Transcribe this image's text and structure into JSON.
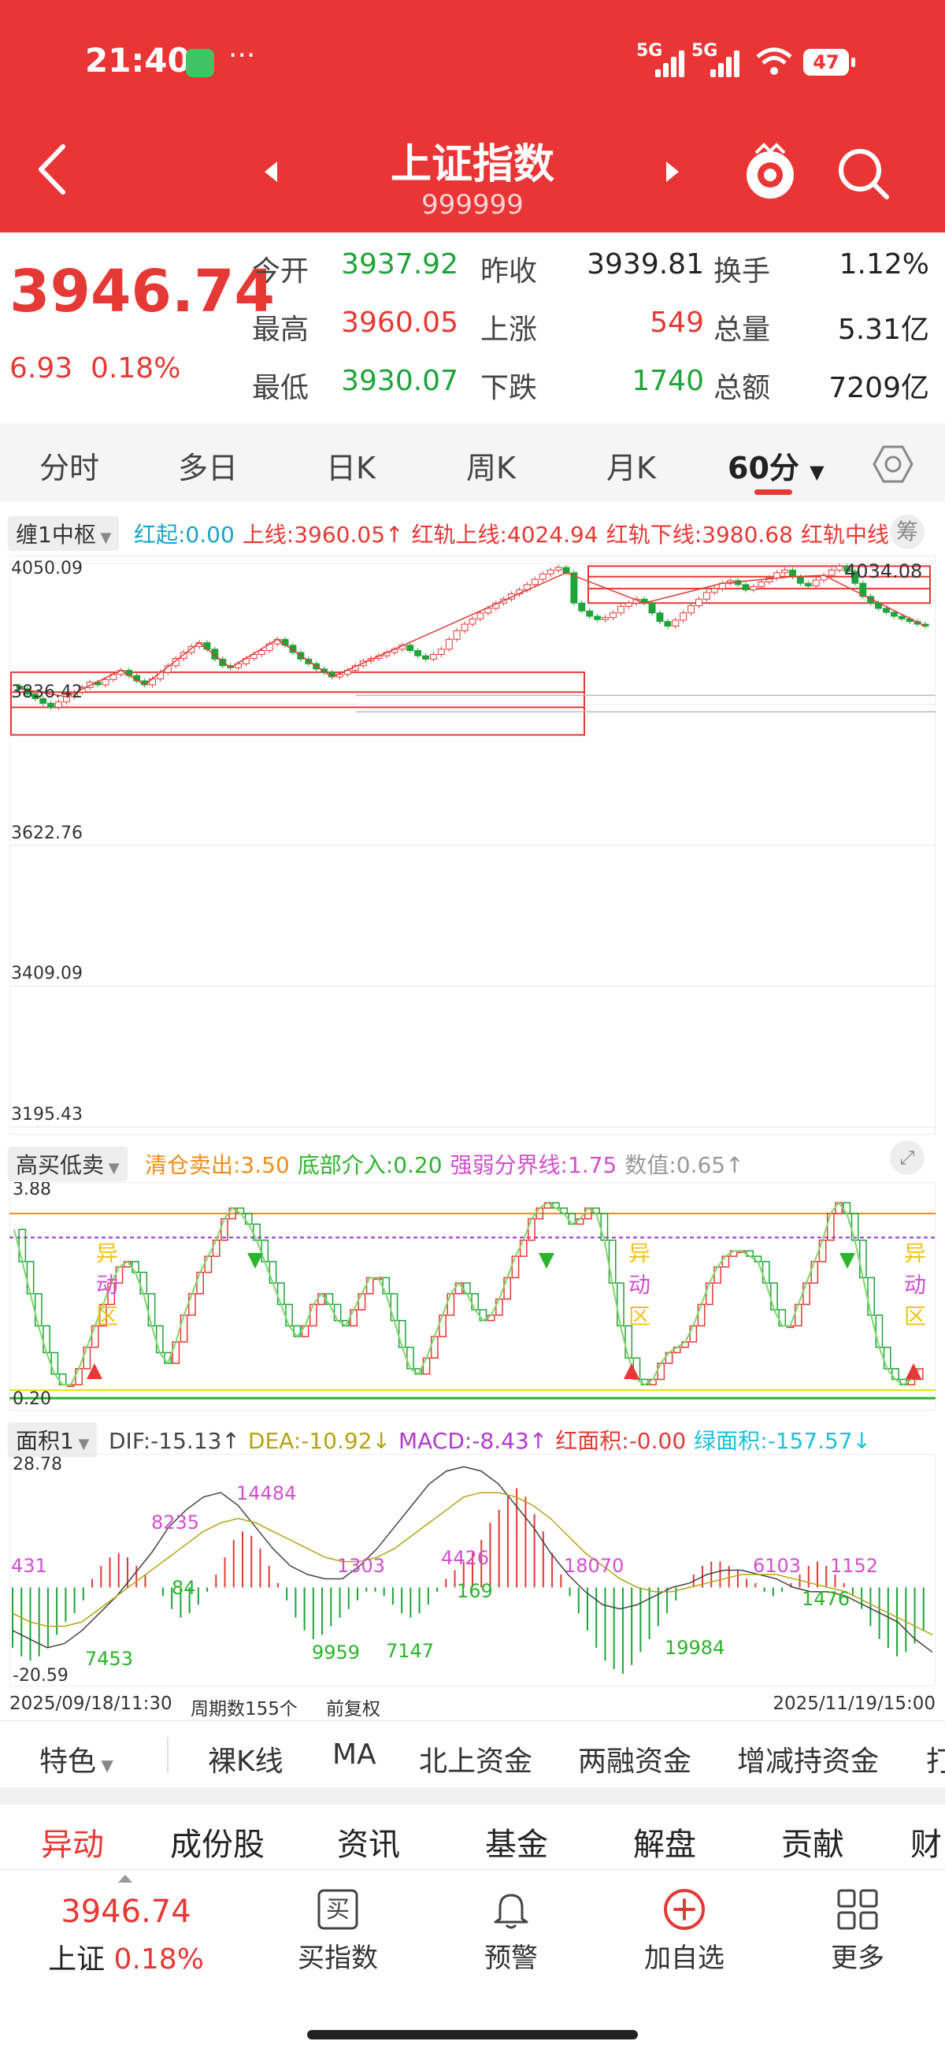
{
  "status_bar": {
    "time": "21:40",
    "dots": "···",
    "sig1": "5G",
    "sig2": "5G",
    "battery": "47"
  },
  "header": {
    "title": "上证指数",
    "code": "999999"
  },
  "quote": {
    "price": "3946.74",
    "change": "6.93",
    "change_pct": "0.18%",
    "fields": [
      {
        "label": "今开",
        "value": "3937.92",
        "color": "green"
      },
      {
        "label": "昨收",
        "value": "3939.81",
        "color": "black"
      },
      {
        "label": "换手",
        "value": "1.12%",
        "color": "black"
      },
      {
        "label": "最高",
        "value": "3960.05",
        "color": "red"
      },
      {
        "label": "上涨",
        "value": "549",
        "color": "red"
      },
      {
        "label": "总量",
        "value": "5.31亿",
        "color": "black"
      },
      {
        "label": "最低",
        "value": "3930.07",
        "color": "green"
      },
      {
        "label": "下跌",
        "value": "1740",
        "color": "green"
      },
      {
        "label": "总额",
        "value": "7209亿",
        "color": "black"
      }
    ]
  },
  "tabs": [
    "分时",
    "多日",
    "日K",
    "周K",
    "月K",
    "60分"
  ],
  "indicator1": {
    "selector": "缠1中枢",
    "items": [
      {
        "text": "红起:0.00",
        "color": "#1aa3c9"
      },
      {
        "text": "上线:3960.05↑",
        "color": "#e53935"
      },
      {
        "text": "红轨上线:4024.94",
        "color": "#e53935"
      },
      {
        "text": "红轨下线:3980.68",
        "color": "#e53935"
      },
      {
        "text": "红轨中线",
        "color": "#e53935"
      }
    ],
    "chip": "筹"
  },
  "kline_axis": {
    "y_labels": [
      "4050.09",
      "3836.42",
      "3622.76",
      "3409.09",
      "3195.43"
    ],
    "last_label": "4034.08"
  },
  "indicator2": {
    "selector": "高买低卖",
    "items": [
      {
        "text": "清仓卖出:3.50",
        "color": "#f28c1a"
      },
      {
        "text": "底部介入:0.20",
        "color": "#2bb52b"
      },
      {
        "text": "强弱分界线:1.75",
        "color": "#d24fd2"
      },
      {
        "text": "数值:0.65↑",
        "color": "#999999"
      }
    ],
    "y_top": "3.88",
    "y_bottom": "0.20",
    "zone_label": [
      "异",
      "动",
      "区"
    ]
  },
  "indicator3": {
    "selector": "面积1",
    "items": [
      {
        "text": "DIF:-15.13↑",
        "color": "#444444"
      },
      {
        "text": "DEA:-10.92↓",
        "color": "#b7a314"
      },
      {
        "text": "MACD:-8.43↑",
        "color": "#b23ad0"
      },
      {
        "text": "红面积:-0.00",
        "color": "#e53935"
      },
      {
        "text": "绿面积:-157.57↓",
        "color": "#1ec1d6"
      }
    ],
    "y_top": "28.78",
    "y_bottom": "-20.59",
    "annotations": [
      "431",
      "8235",
      "14484",
      "1303",
      "4426",
      "18070",
      "6103",
      "1152",
      "7453",
      "84",
      "9959",
      "7147",
      "169",
      "19984",
      "1476"
    ]
  },
  "footer": {
    "start": "2025/09/18/11:30",
    "period": "周期数155个",
    "adj": "前复权",
    "end": "2025/11/19/15:00"
  },
  "features": [
    "特色",
    "裸K线",
    "MA",
    "北上资金",
    "两融资金",
    "增减持资金",
    "打"
  ],
  "news_tabs": [
    "异动",
    "成份股",
    "资讯",
    "基金",
    "解盘",
    "贡献",
    "财"
  ],
  "bottom": {
    "price": "3946.74",
    "name": "上证",
    "pct": "0.18%",
    "items": [
      "买指数",
      "预警",
      "加自选",
      "更多"
    ],
    "buy_glyph": "买"
  },
  "chart_data": [
    {
      "type": "candlestick",
      "title": "",
      "ylim": [
        3195.43,
        4050.09
      ],
      "y_ticks": [
        4050.09,
        3836.42,
        3622.76,
        3409.09,
        3195.43
      ],
      "x_range": [
        "2025/09/18/11:30",
        "2025/11/19/15:00"
      ],
      "periods": 155,
      "series": [
        {
          "name": "",
          "values": [
            3860,
            3852,
            3845,
            3838,
            3832,
            3840,
            3848,
            3855,
            3862,
            3870,
            3866,
            3874,
            3882,
            3888,
            3880,
            3872,
            3866,
            3875,
            3885,
            3895,
            3906,
            3915,
            3924,
            3930,
            3920,
            3905,
            3895,
            3892,
            3898,
            3906,
            3912,
            3918,
            3928,
            3935,
            3926,
            3915,
            3905,
            3898,
            3890,
            3885,
            3878,
            3882,
            3888,
            3895,
            3902,
            3906,
            3910,
            3915,
            3920,
            3926,
            3918,
            3910,
            3905,
            3912,
            3920,
            3935,
            3948,
            3958,
            3966,
            3975,
            3982,
            3990,
            3996,
            4004,
            4010,
            4018,
            4026,
            4034,
            4040,
            4044,
            4036,
            3990,
            3978,
            3970,
            3965,
            3968,
            3975,
            3985,
            3990,
            3996,
            3990,
            3975,
            3962,
            3955,
            3964,
            3975,
            3986,
            3996,
            4006,
            4012,
            4020,
            4024,
            4018,
            4010,
            4015,
            4022,
            4028,
            4036,
            4040,
            4030,
            4020,
            4016,
            4025,
            4032,
            4040,
            4046,
            4038,
            4020,
            4000,
            3990,
            3982,
            3976,
            3970,
            3966,
            3962,
            3958,
            3955
          ]
        }
      ]
    },
    {
      "type": "line",
      "title": "",
      "ylim": [
        0.2,
        3.88
      ],
      "series": [
        {
          "name": "",
          "values": [
            3.2,
            2.6,
            2.0,
            1.4,
            0.9,
            0.5,
            0.3,
            0.3,
            0.6,
            1.0,
            1.4,
            1.8,
            2.2,
            2.5,
            2.6,
            2.4,
            2.0,
            1.4,
            0.9,
            0.7,
            1.1,
            1.6,
            2.0,
            2.4,
            2.7,
            3.0,
            3.4,
            3.6,
            3.5,
            3.3,
            3.0,
            2.6,
            2.2,
            1.8,
            1.4,
            1.2,
            1.4,
            1.8,
            2.0,
            1.8,
            1.5,
            1.4,
            1.7,
            2.0,
            2.3,
            2.3,
            2.0,
            1.5,
            1.0,
            0.6,
            0.5,
            0.8,
            1.2,
            1.6,
            2.0,
            2.2,
            2.0,
            1.7,
            1.5,
            1.6,
            1.9,
            2.3,
            2.7,
            3.0,
            3.4,
            3.6,
            3.7,
            3.6,
            3.5,
            3.3,
            3.4,
            3.6,
            3.5,
            3.0,
            2.2,
            1.4,
            0.8,
            0.4,
            0.3,
            0.4,
            0.7,
            0.9,
            1.0,
            1.1,
            1.4,
            1.8,
            2.2,
            2.5,
            2.7,
            2.8,
            2.8,
            2.7,
            2.6,
            2.2,
            1.7,
            1.4,
            1.4,
            1.8,
            2.2,
            2.6,
            3.0,
            3.5,
            3.7,
            3.5,
            3.0,
            2.3,
            1.6,
            1.0,
            0.6,
            0.4,
            0.3,
            0.4,
            0.6
          ]
        }
      ]
    },
    {
      "type": "bar",
      "title": "",
      "ylim": [
        -20.59,
        28.78
      ],
      "series": [
        {
          "name": "MACD",
          "values": [
            -14,
            -16,
            -17,
            -16,
            -14,
            -11,
            -8,
            -6,
            -3,
            2,
            5,
            7,
            8,
            7,
            5,
            3,
            0,
            -2,
            -5,
            -7,
            -6,
            -4,
            -1,
            3,
            7,
            11,
            13,
            12,
            9,
            5,
            1,
            -3,
            -7,
            -10,
            -12,
            -11,
            -9,
            -7,
            -5,
            -3,
            -1,
            -1,
            -2,
            -4,
            -6,
            -7,
            -6,
            -4,
            -1,
            2,
            4,
            6,
            8,
            11,
            15,
            18,
            21,
            23,
            21,
            17,
            13,
            8,
            3,
            -2,
            -6,
            -10,
            -14,
            -17,
            -19,
            -20,
            -18,
            -15,
            -12,
            -9,
            -6,
            -3,
            0,
            3,
            5,
            6,
            6,
            5,
            4,
            2,
            1,
            -1,
            -2,
            -1,
            1,
            3,
            5,
            6,
            5,
            3,
            1,
            -2,
            -5,
            -9,
            -12,
            -14,
            -16,
            -15,
            -13,
            -10
          ]
        },
        {
          "name": "DIF",
          "values": [
            -10,
            -12,
            -14,
            -13,
            -10,
            -6,
            -2,
            3,
            8,
            14,
            18,
            21,
            22,
            19,
            14,
            9,
            5,
            3,
            2,
            2,
            5,
            9,
            14,
            19,
            24,
            27,
            28,
            27,
            24,
            19,
            14,
            8,
            3,
            -1,
            -4,
            -5,
            -4,
            -2,
            0,
            1,
            3,
            4,
            4,
            3,
            2,
            0,
            -1,
            -1,
            -2,
            -4,
            -6,
            -8,
            -12,
            -15
          ]
        },
        {
          "name": "DEA",
          "values": [
            -6,
            -8,
            -9,
            -9,
            -8,
            -5,
            -2,
            1,
            4,
            7,
            10,
            13,
            15,
            16,
            15,
            13,
            11,
            9,
            7,
            6,
            6,
            7,
            9,
            12,
            15,
            18,
            21,
            22,
            22,
            21,
            19,
            16,
            12,
            8,
            5,
            2,
            0,
            -1,
            -1,
            0,
            1,
            2,
            3,
            3,
            3,
            2,
            1,
            0,
            -1,
            -3,
            -5,
            -7,
            -9,
            -11
          ]
        }
      ]
    }
  ]
}
